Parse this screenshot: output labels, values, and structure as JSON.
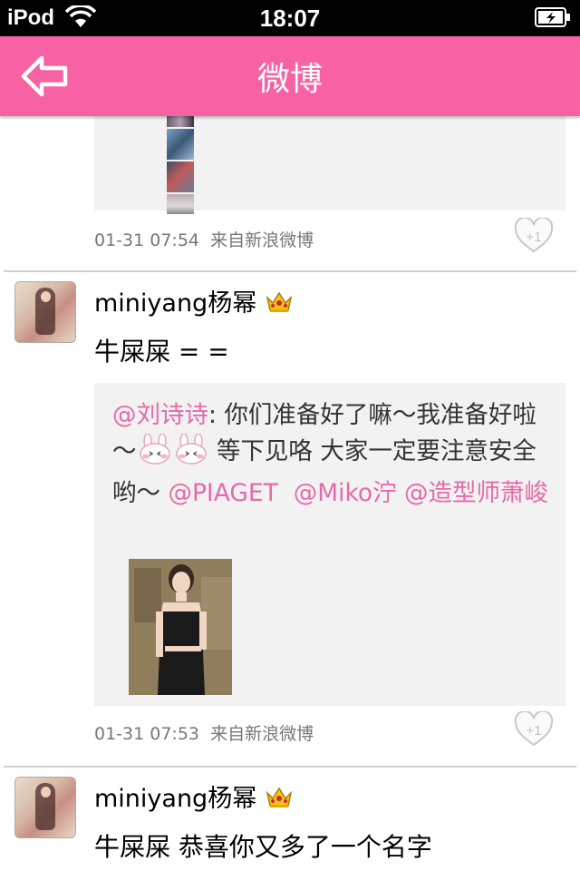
{
  "status_bar": {
    "carrier": "iPod",
    "time": "18:07"
  },
  "nav": {
    "title": "微博",
    "back_icon": "back-arrow-icon"
  },
  "colors": {
    "nav_background": "#f862a4",
    "mention": "#e76aa8"
  },
  "posts": [
    {
      "timestamp": "01-31 07:54",
      "source": "来自新浪微博",
      "like_label": "+1"
    },
    {
      "username": "miniyang杨幂",
      "badge_icon": "crown-icon",
      "text": "牛屎屎 = =",
      "quote": {
        "mention1": "@刘诗诗",
        "text1": ": 你们准备好了嘛～我准备好啦～",
        "text2": " 等下见咯 大家一定要注意安全哟～ ",
        "mention2": "@PIAGET",
        "mention3": "@Miko泞",
        "mention4": "@造型师萧峻"
      },
      "timestamp": "01-31 07:53",
      "source": "来自新浪微博",
      "like_label": "+1"
    },
    {
      "username": "miniyang杨幂",
      "badge_icon": "crown-icon",
      "text": "牛屎屎 恭喜你又多了一个名字"
    }
  ]
}
